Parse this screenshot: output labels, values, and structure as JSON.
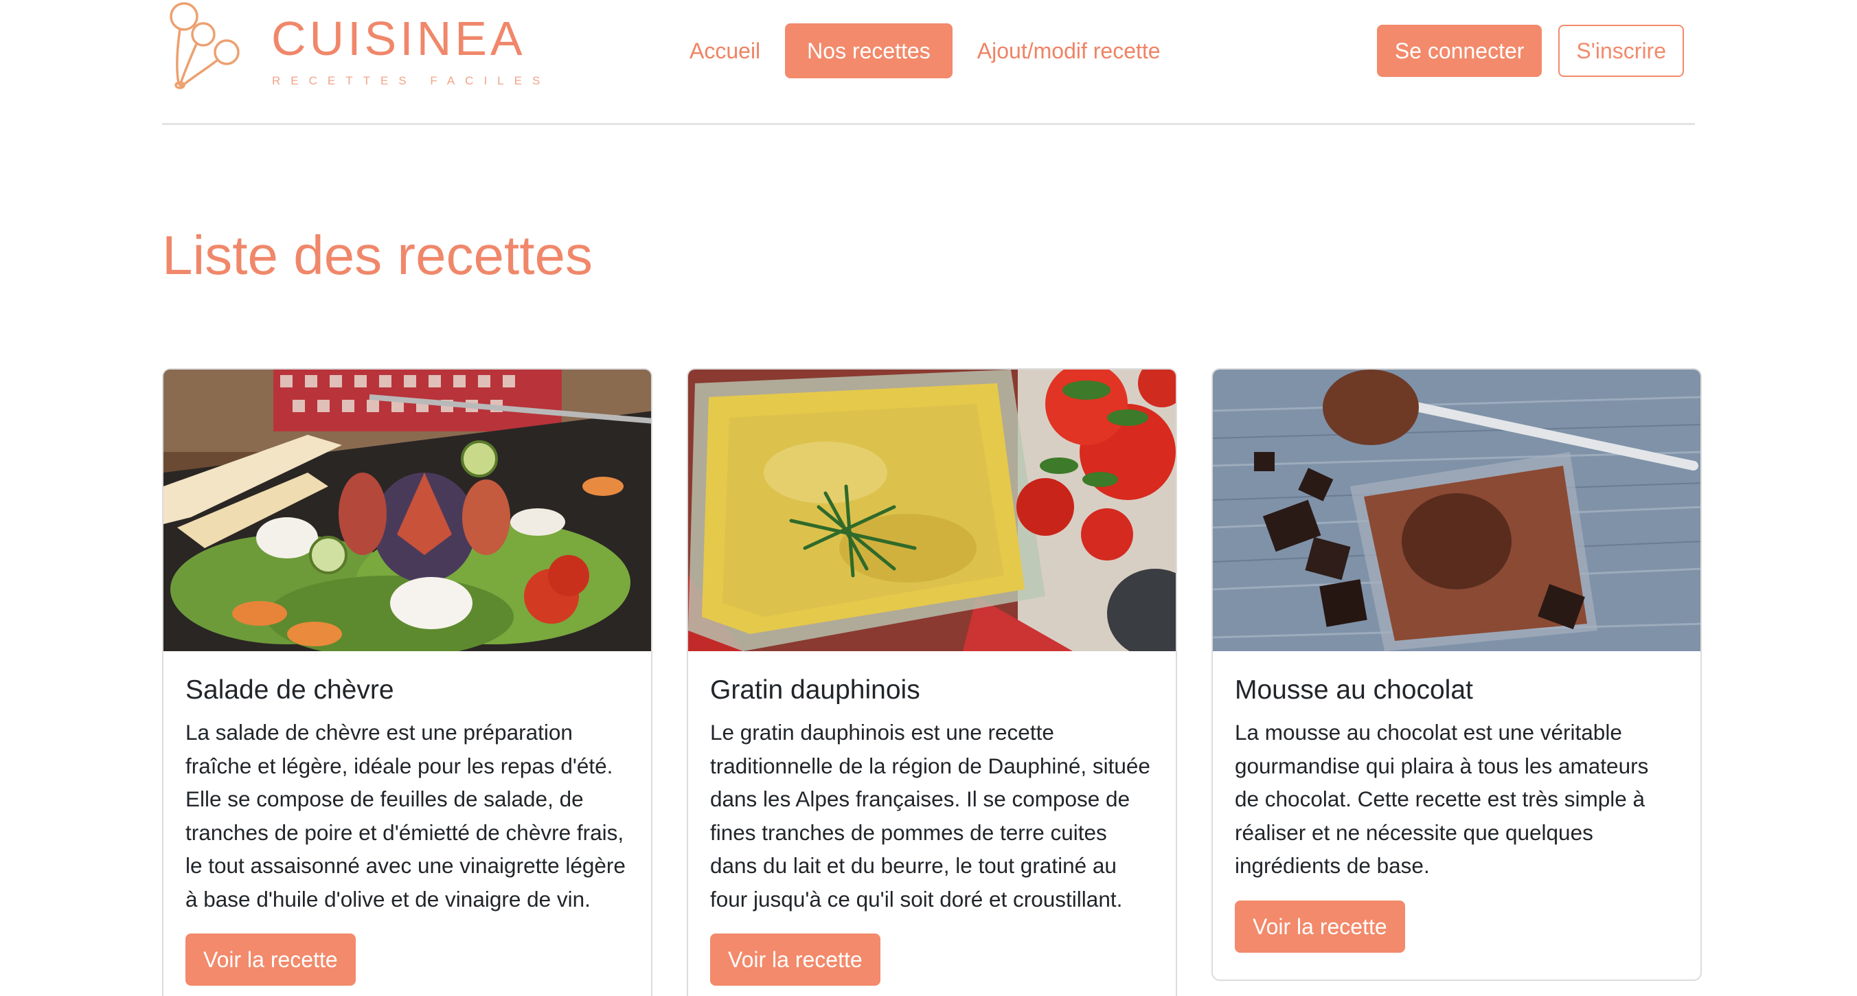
{
  "brand": {
    "title": "CUISINEA",
    "tagline": "RECETTES FACILES"
  },
  "nav": {
    "items": [
      {
        "label": "Accueil",
        "active": false
      },
      {
        "label": "Nos recettes",
        "active": true
      },
      {
        "label": "Ajout/modif recette",
        "active": false
      }
    ]
  },
  "auth": {
    "login_label": "Se connecter",
    "signup_label": "S'inscrire"
  },
  "page": {
    "title": "Liste des recettes"
  },
  "recipes": [
    {
      "title": "Salade de chèvre",
      "description": "La salade de chèvre est une préparation fraîche et légère, idéale pour les repas d'été. Elle se compose de feuilles de salade, de tranches de poire et d'émietté de chèvre frais, le tout assaisonné avec une vinaigrette légère à base d'huile d'olive et de vinaigre de vin.",
      "button_label": "Voir la recette",
      "image": "salad-photo"
    },
    {
      "title": "Gratin dauphinois",
      "description": "Le gratin dauphinois est une recette traditionnelle de la région de Dauphiné, située dans les Alpes françaises. Il se compose de fines tranches de pommes de terre cuites dans du lait et du beurre, le tout gratiné au four jusqu'à ce qu'il soit doré et croustillant.",
      "button_label": "Voir la recette",
      "image": "gratin-photo"
    },
    {
      "title": "Mousse au chocolat",
      "description": "La mousse au chocolat est une véritable gourmandise qui plaira à tous les amateurs de chocolat. Cette recette est très simple à réaliser et ne nécessite que quelques ingrédients de base.",
      "button_label": "Voir la recette",
      "image": "chocolate-mousse-photo"
    }
  ],
  "colors": {
    "accent": "#f28a6b",
    "text": "#212529",
    "border": "#dcdcdc"
  }
}
